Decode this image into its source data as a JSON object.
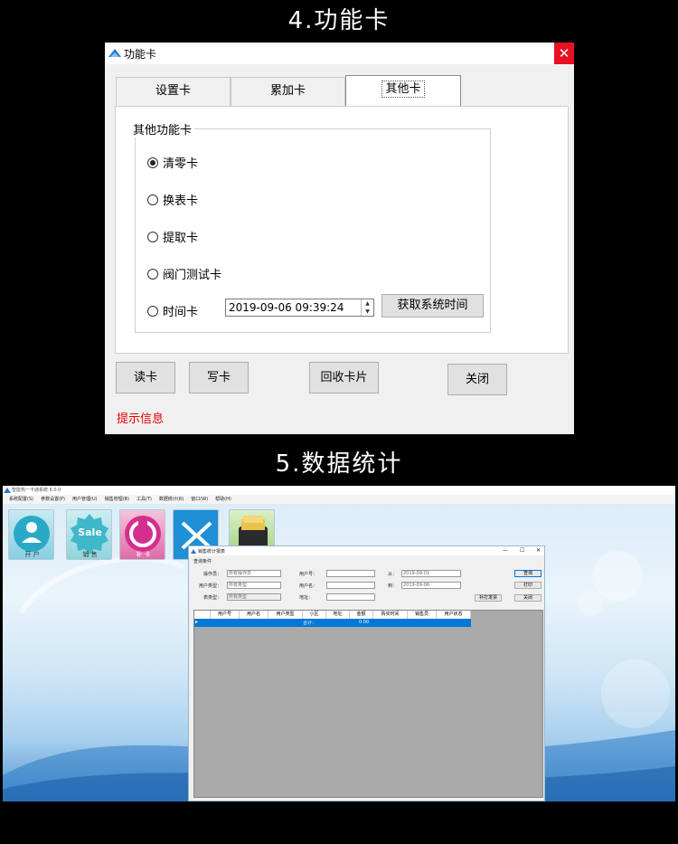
{
  "headings": {
    "section4": "4.功能卡",
    "section5": "5.数据统计"
  },
  "dialog": {
    "title": "功能卡",
    "close_glyph": "✕",
    "tabs": [
      "设置卡",
      "累加卡",
      "其他卡"
    ],
    "active_tab": "其他卡",
    "group_title": "其他功能卡",
    "options": [
      "清零卡",
      "换表卡",
      "提取卡",
      "阀门测试卡",
      "时间卡"
    ],
    "selected_option": "清零卡",
    "datetime_value": "2019-09-06 09:39:24",
    "get_time_button": "获取系统时间",
    "buttons": {
      "read": "读卡",
      "write": "写卡",
      "recycle": "回收卡片",
      "close": "关闭"
    },
    "hint": "提示信息"
  },
  "app": {
    "title": "智能热一卡通系统 6.0.0",
    "menu": [
      "系统配置(S)",
      "参数设置(P)",
      "用户管理(U)",
      "销售管理(B)",
      "工具(T)",
      "数据统计(R)",
      "窗口(W)",
      "帮助(H)"
    ],
    "tiles": [
      {
        "label": "开 户",
        "color": "#2aa9c7"
      },
      {
        "label": "Sale",
        "sub": "销 售",
        "color": "#3fb8c9"
      },
      {
        "label": "补 卡",
        "color": "#d42f8e"
      },
      {
        "label": "",
        "color": "#1f8fd6"
      },
      {
        "label": "",
        "color": "#e8c24a"
      }
    ],
    "report": {
      "title": "销售统计报表",
      "window_controls": [
        "—",
        "☐",
        "✕"
      ],
      "section": "查询条件",
      "operator_label": "操作员：",
      "operator_value": "所有操作员",
      "usertype_label": "用户类型：",
      "usertype_value": "所有类型",
      "metertype_label": "表类型：",
      "metertype_value": "所有类型",
      "userno_label": "用户号：",
      "username_label": "用户名：",
      "address_label": "地址：",
      "from_label": "从：",
      "from_value": "2019-09-01",
      "to_label": "到：",
      "to_value": "2019-09-06",
      "query_button": "查询",
      "print_button": "打印",
      "close_button": "关闭",
      "invoice_button": "补打发票",
      "columns": [
        "用户号",
        "用户名",
        "用户类型",
        "小区",
        "地址",
        "金额",
        "购买时间",
        "销售员",
        "用户状态"
      ],
      "total_label": "合计：",
      "total_value": "0.00"
    }
  }
}
